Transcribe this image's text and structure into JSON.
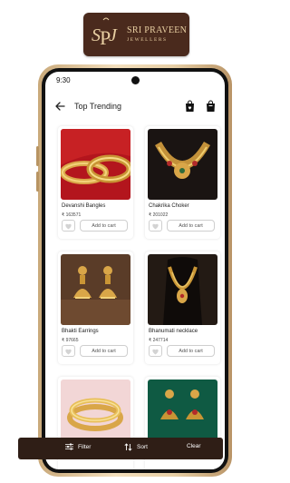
{
  "brand": {
    "name": "SRI PRAVEEN",
    "subtitle": "JEWELLERS",
    "monogram": "SPJ",
    "color": "#4a2a1d",
    "accent": "#e8cfa2"
  },
  "status_bar": {
    "time": "9:30"
  },
  "header": {
    "back_icon": "arrow-left-icon",
    "title": "Top Trending",
    "icons": [
      "wishlist-bag-icon",
      "cart-bag-icon"
    ]
  },
  "products": [
    {
      "name": "Devanshi Bangles",
      "price": "₹ 163571",
      "add_label": "Add to cart",
      "image": "gold-bangles-on-red"
    },
    {
      "name": "Chakrika Choker",
      "price": "₹ 201022",
      "add_label": "Add to cart",
      "image": "gold-choker"
    },
    {
      "name": "Bhakti Earrings",
      "price": "₹ 97665",
      "add_label": "Add to cart",
      "image": "gold-jhumka-earrings"
    },
    {
      "name": "Bhanumati necklace",
      "price": "₹ 247714",
      "add_label": "Add to cart",
      "image": "gold-necklace-on-bust"
    },
    {
      "name": "",
      "price": "",
      "add_label": "",
      "image": "gold-bangles-pink"
    },
    {
      "name": "",
      "price": "",
      "add_label": "",
      "image": "gold-earrings-green"
    }
  ],
  "bottom_bar": {
    "filter": "Filter",
    "sort": "Sort",
    "clear": "Clear",
    "color": "#2f1e16"
  }
}
